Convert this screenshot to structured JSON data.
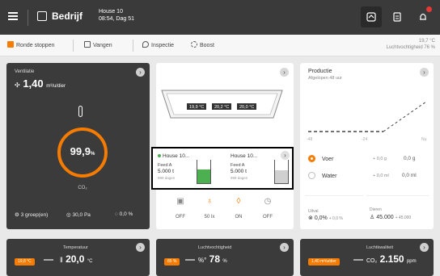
{
  "header": {
    "company": "Bedrijf",
    "house_name": "House 10",
    "house_info": "08:54, Dag 51",
    "alarm_count": "8"
  },
  "tabs": [
    {
      "label": "Ronde stoppen"
    },
    {
      "label": "Vangen"
    },
    {
      "label": "Inspectie"
    },
    {
      "label": "Boost"
    }
  ],
  "weather": {
    "temp": "19,7 °C",
    "humidity": "Luchtvochtigheid 76 %"
  },
  "ventilation": {
    "title": "Ventilatie",
    "value": "1,40",
    "unit": "m³/u/dier",
    "ring_value": "99,9",
    "ring_unit": "%",
    "ring_label": "CO₂",
    "footer": [
      "3 groep(en)",
      "30,0 Pa",
      "0,0 %"
    ]
  },
  "climate": {
    "temps": [
      "19,9 °C",
      "20,2 °C",
      "20,0 °C"
    ],
    "silos": [
      {
        "name": "House 10...",
        "feed": "Feed A",
        "amount": "5.000 t",
        "sub": "999 dagen"
      },
      {
        "name": "House 10...",
        "feed": "Feed A",
        "amount": "5.000 t",
        "sub": "999 dagen"
      }
    ],
    "status": [
      "OFF",
      "50 lx",
      "ON",
      "OFF"
    ]
  },
  "production": {
    "title": "Productie",
    "subtitle": "Afgelopen 48 uur",
    "axis": [
      "-48",
      "-24",
      "Nu"
    ],
    "voer": {
      "label": "Voer",
      "per": "+ 0,0 g",
      "total": "0,0 g"
    },
    "water": {
      "label": "Water",
      "per": "+ 0,0 ml",
      "total": "0,0 ml"
    },
    "uitval": {
      "label": "Uitval",
      "value": "0,0%",
      "delta": "+ 0,0 %"
    },
    "dieren": {
      "label": "Dieren",
      "value": "45.000",
      "delta": "+ 45.000"
    }
  },
  "bottom": {
    "temperature": {
      "title": "Temperatuur",
      "badge": "19,8 °C",
      "value": "20,0",
      "unit": "°C"
    },
    "humidity": {
      "title": "Luchtvochtigheid",
      "badge": "85 %",
      "value": "78",
      "unit": "%"
    },
    "air_quality": {
      "title": "Luchtkwaliteit",
      "badge": "1,40 m³/u/dier",
      "value": "2.150",
      "unit": "ppm"
    }
  },
  "colors": {
    "accent": "#f57c00",
    "dark": "#3b3b3b",
    "green": "#4caf50"
  }
}
